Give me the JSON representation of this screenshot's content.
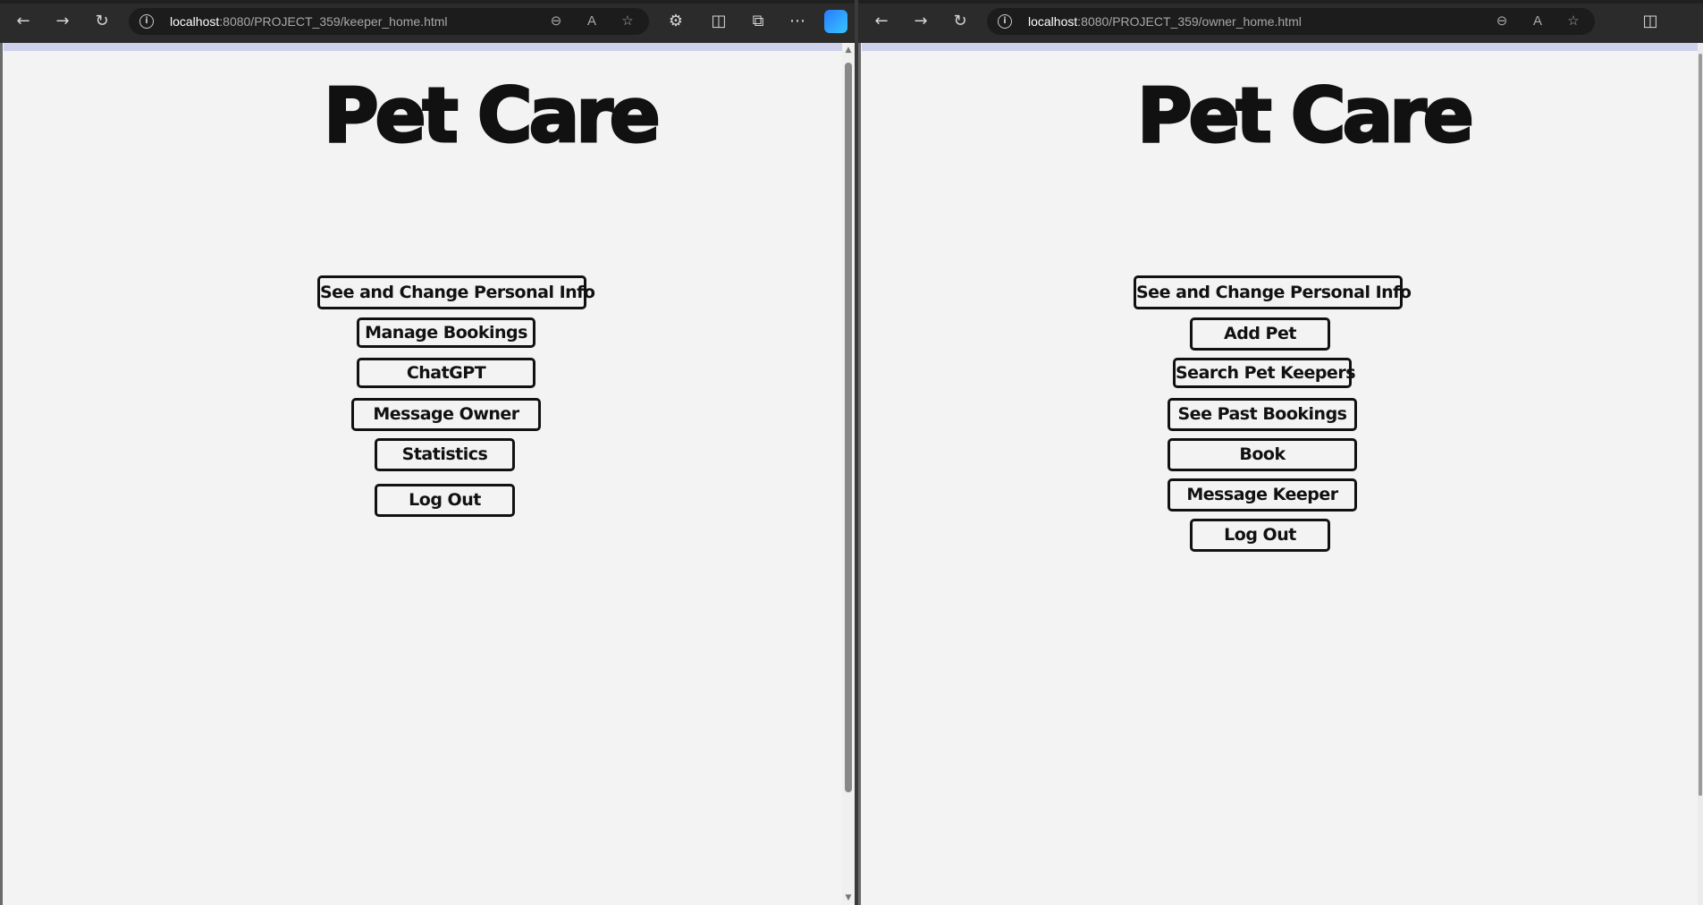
{
  "left_window": {
    "address": {
      "host": "localhost",
      "path": ":8080/PROJECT_359/keeper_home.html"
    },
    "title": "Pet Care",
    "buttons": [
      "See and Change Personal Info",
      "Manage Bookings",
      "ChatGPT",
      "Message Owner",
      "Statistics",
      "Log Out"
    ]
  },
  "right_window": {
    "address": {
      "host": "localhost",
      "path": ":8080/PROJECT_359/owner_home.html"
    },
    "title": "Pet Care",
    "buttons": [
      "See and Change Personal Info",
      "Add Pet",
      "Search Pet Keepers",
      "See Past Bookings",
      "Book",
      "Message Keeper",
      "Log Out"
    ]
  },
  "icons": {
    "back": "back-arrow-icon",
    "forward": "forward-arrow-icon",
    "refresh": "refresh-icon",
    "info": "site-info-icon",
    "zoom": "zoom-out-icon",
    "read_aloud": "read-aloud-icon",
    "favorite": "star-icon",
    "extensions": "extensions-icon",
    "split_screen": "split-screen-icon",
    "collections": "collections-icon",
    "more": "more-icon",
    "copilot": "copilot-icon"
  },
  "colors": {
    "page_background": "#f3f3f3",
    "toolbar_background": "#2b2b2b",
    "page_top_band": "#cfd0ea",
    "button_border": "#111111"
  }
}
